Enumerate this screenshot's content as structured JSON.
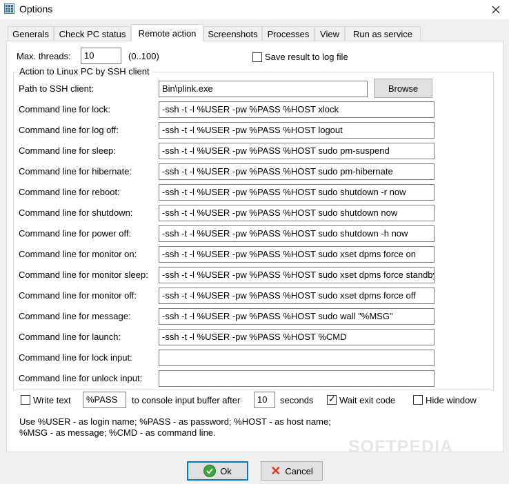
{
  "window": {
    "title": "Options"
  },
  "tabs": [
    "Generals",
    "Check PC status",
    "Remote action",
    "Screenshots",
    "Processes",
    "View",
    "Run as service"
  ],
  "max_threads": {
    "label": "Max. threads:",
    "value": "10",
    "range": "(0..100)"
  },
  "save_result": {
    "label": "Save result to log file",
    "checked": false
  },
  "group": {
    "title": "Action to Linux PC by SSH client"
  },
  "ssh": {
    "path_label": "Path to SSH client:",
    "path_value": "Bin\\plink.exe",
    "browse": "Browse"
  },
  "commands": [
    {
      "label": "Command line for lock:",
      "value": "-ssh -t -l %USER -pw %PASS %HOST xlock"
    },
    {
      "label": "Command line for log off:",
      "value": "-ssh -t -l %USER -pw %PASS %HOST logout"
    },
    {
      "label": "Command line for sleep:",
      "value": "-ssh -t -l %USER -pw %PASS %HOST sudo pm-suspend"
    },
    {
      "label": "Command line for hibernate:",
      "value": "-ssh -t -l %USER -pw %PASS %HOST sudo pm-hibernate"
    },
    {
      "label": "Command line for reboot:",
      "value": "-ssh -t -l %USER -pw %PASS %HOST sudo shutdown -r now"
    },
    {
      "label": "Command line for shutdown:",
      "value": "-ssh -t -l %USER -pw %PASS %HOST sudo shutdown now"
    },
    {
      "label": "Command line for power off:",
      "value": "-ssh -t -l %USER -pw %PASS %HOST sudo shutdown -h now"
    },
    {
      "label": "Command line for monitor on:",
      "value": "-ssh -t -l %USER -pw %PASS %HOST sudo xset dpms force on"
    },
    {
      "label": "Command line for monitor sleep:",
      "value": "-ssh -t -l %USER -pw %PASS %HOST sudo xset dpms force standby"
    },
    {
      "label": "Command line for monitor off:",
      "value": "-ssh -t -l %USER -pw %PASS %HOST sudo xset dpms force off"
    },
    {
      "label": "Command line for message:",
      "value": "-ssh -t -l %USER -pw %PASS %HOST sudo wall \"%MSG\""
    },
    {
      "label": "Command line for launch:",
      "value": "-ssh -t -l %USER -pw %PASS %HOST %CMD"
    },
    {
      "label": "Command line for lock input:",
      "value": ""
    },
    {
      "label": "Command line for unlock input:",
      "value": ""
    }
  ],
  "write_text": {
    "label": "Write text",
    "checked": false,
    "value": "%PASS",
    "middle": "to console input buffer after",
    "seconds_value": "10",
    "seconds_label": "seconds"
  },
  "wait_exit": {
    "label": "Wait exit code",
    "checked": true
  },
  "hide_window": {
    "label": "Hide window",
    "checked": false
  },
  "hint": {
    "line1": "Use %USER - as login name; %PASS - as password; %HOST - as host name;",
    "line2": "%MSG - as message; %CMD - as command line."
  },
  "watermark": "SOFTPEDIA",
  "buttons": {
    "ok": "Ok",
    "cancel": "Cancel"
  }
}
